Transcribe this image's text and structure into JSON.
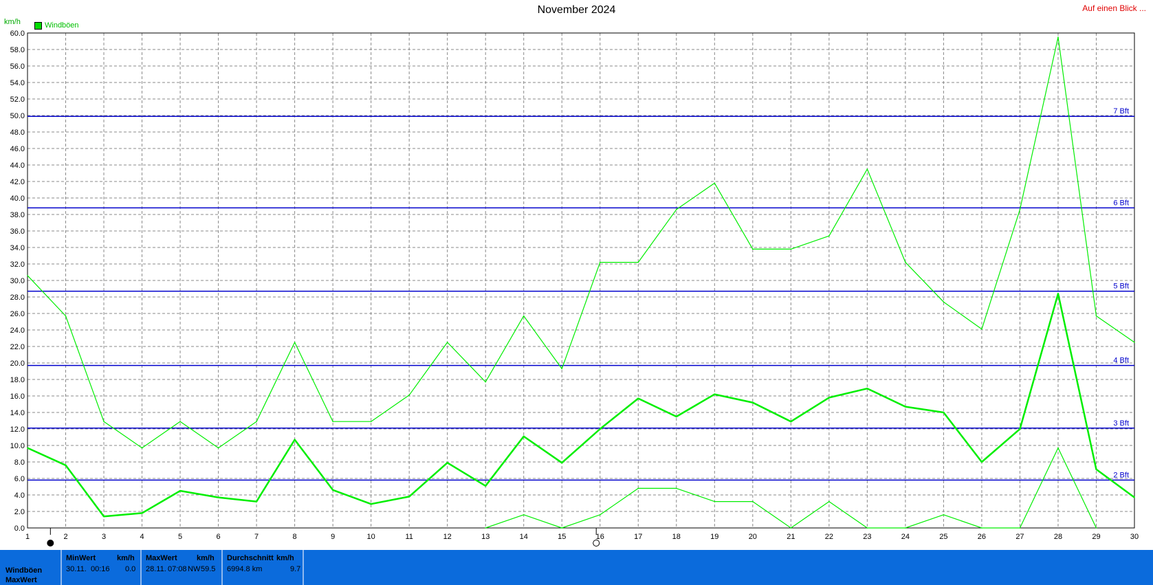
{
  "header": {
    "title": "November 2024",
    "link": "Auf einen Blick ...",
    "unit": "km/h",
    "legend_label": "Windböen"
  },
  "chart_data": {
    "type": "line",
    "title": "November 2024",
    "ylabel": "km/h",
    "xlabel": "",
    "ylim": [
      0,
      60
    ],
    "y_ticks": [
      "0.0",
      "2.0",
      "4.0",
      "6.0",
      "8.0",
      "10.0",
      "12.0",
      "14.0",
      "16.0",
      "18.0",
      "20.0",
      "22.0",
      "24.0",
      "26.0",
      "28.0",
      "30.0",
      "32.0",
      "34.0",
      "36.0",
      "38.0",
      "40.0",
      "42.0",
      "44.0",
      "46.0",
      "48.0",
      "50.0",
      "52.0",
      "54.0",
      "56.0",
      "58.0",
      "60.0"
    ],
    "x": [
      1,
      2,
      3,
      4,
      5,
      6,
      7,
      8,
      9,
      10,
      11,
      12,
      13,
      14,
      15,
      16,
      17,
      18,
      19,
      20,
      21,
      22,
      23,
      24,
      25,
      26,
      27,
      28,
      29,
      30
    ],
    "x_ticks": [
      "1",
      "2",
      "3",
      "4",
      "5",
      "6",
      "7",
      "8",
      "9",
      "10",
      "11",
      "12",
      "13",
      "14",
      "15",
      "16",
      "17",
      "18",
      "19",
      "20",
      "21",
      "22",
      "23",
      "24",
      "25",
      "26",
      "27",
      "28",
      "29",
      "30"
    ],
    "grid": true,
    "legend": "top-left",
    "series": [
      {
        "name": "Windböen",
        "role": "max",
        "color": "#00ee00",
        "values": [
          30.6,
          25.7,
          12.9,
          9.7,
          12.9,
          9.7,
          12.9,
          22.5,
          12.9,
          12.9,
          16.1,
          22.5,
          17.7,
          25.7,
          19.3,
          32.2,
          32.2,
          38.6,
          41.8,
          33.8,
          33.8,
          35.4,
          43.5,
          32.2,
          27.4,
          24.1,
          38.6,
          59.5,
          25.7,
          22.5
        ]
      },
      {
        "role": "average",
        "color": "#00ee00",
        "values": [
          9.7,
          7.6,
          1.4,
          1.8,
          4.5,
          3.7,
          3.2,
          10.7,
          4.6,
          2.9,
          3.8,
          7.9,
          5.1,
          11.1,
          7.9,
          12.0,
          15.7,
          13.5,
          16.2,
          15.2,
          12.9,
          15.8,
          16.9,
          14.7,
          14.0,
          8.0,
          12.0,
          28.4,
          7.1,
          3.7
        ]
      },
      {
        "role": "min",
        "color": "#00ee00",
        "values": [
          null,
          null,
          null,
          null,
          null,
          null,
          null,
          null,
          null,
          null,
          null,
          null,
          0.0,
          1.6,
          0.0,
          1.6,
          4.8,
          4.8,
          3.2,
          3.2,
          0.0,
          3.2,
          0.0,
          0.0,
          1.6,
          0.0,
          0.0,
          9.7,
          0.0,
          null
        ]
      }
    ],
    "reference_lines": [
      {
        "label": "2 Bft",
        "value": 5.8
      },
      {
        "label": "3 Bft",
        "value": 12.1
      },
      {
        "label": "4 Bft",
        "value": 19.7
      },
      {
        "label": "5 Bft",
        "value": 28.7
      },
      {
        "label": "6 Bft",
        "value": 38.8
      },
      {
        "label": "7 Bft",
        "value": 49.9
      }
    ],
    "reference_color": "#0000cc",
    "moon_markers": [
      {
        "day": 1.6,
        "phase": "new-moon"
      },
      {
        "day": 15.9,
        "phase": "full-moon"
      }
    ]
  },
  "stats": {
    "row_labels": [
      "Windböen",
      "MaxWert"
    ],
    "min": {
      "header": "MinWert",
      "unit": "km/h",
      "date": "30.11.",
      "time": "00:16",
      "value": "0.0"
    },
    "max": {
      "header": "MaxWert",
      "unit": "km/h",
      "date": "28.11.",
      "time": "07:08",
      "direction": "NW",
      "value": "59.5"
    },
    "avg": {
      "header": "Durchschnitt",
      "unit": "km/h",
      "distance": "6994.8 km",
      "value": "9.7"
    }
  },
  "colors": {
    "series": "#00ee00",
    "reference": "#0000cc",
    "stats_bg": "#0b6bdc",
    "link": "#e00000"
  }
}
